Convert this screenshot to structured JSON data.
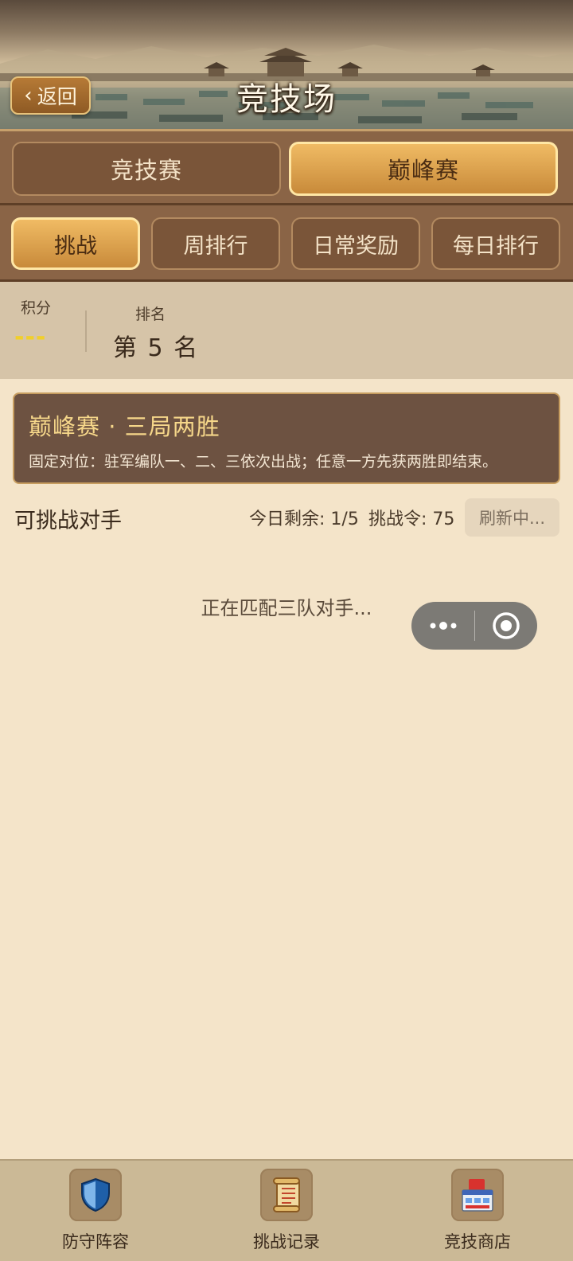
{
  "header": {
    "back_label": "返回",
    "title": "竞技场"
  },
  "mode_tabs": [
    {
      "label": "竞技赛",
      "active": false
    },
    {
      "label": "巅峰赛",
      "active": true
    }
  ],
  "sub_tabs": [
    {
      "label": "挑战",
      "active": true
    },
    {
      "label": "周排行",
      "active": false
    },
    {
      "label": "日常奖励",
      "active": false
    },
    {
      "label": "每日排行",
      "active": false
    }
  ],
  "score": {
    "label": "积分",
    "value": "---"
  },
  "rank": {
    "label": "排名",
    "value": "第 5 名"
  },
  "info_card": {
    "title": "巅峰赛 · 三局两胜",
    "description": "固定对位：驻军编队一、二、三依次出战；任意一方先获两胜即结束。"
  },
  "opponents": {
    "title": "可挑战对手",
    "remaining": "今日剩余: 1/5",
    "tokens": "挑战令: 75",
    "refresh_label": "刷新中...",
    "status": "正在匹配三队对手..."
  },
  "bottom_nav": [
    {
      "label": "防守阵容",
      "icon": "shield-icon"
    },
    {
      "label": "挑战记录",
      "icon": "scroll-icon"
    },
    {
      "label": "竞技商店",
      "icon": "shop-icon"
    }
  ],
  "colors": {
    "accent_gold": "#f0bb64",
    "panel_brown": "#8a6446",
    "background": "#f4e4c9",
    "score_yellow": "#f1cf2a"
  }
}
